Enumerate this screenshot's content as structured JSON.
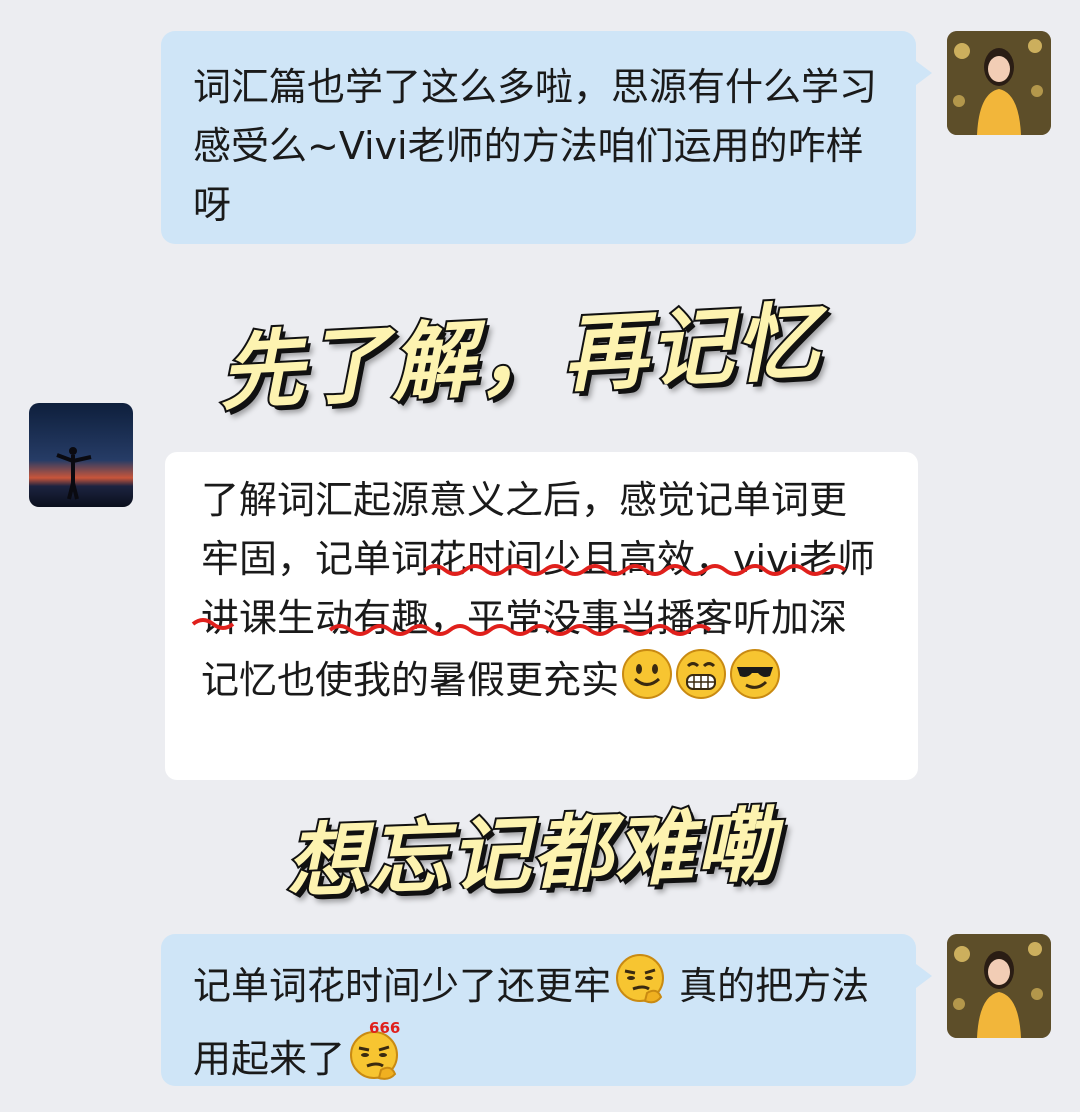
{
  "messages": [
    {
      "side": "right",
      "text": "词汇篇也学了这么多啦，思源有什么学习感受么~Vivi老师的方法咱们运用的咋样呀"
    },
    {
      "side": "left",
      "text": "了解词汇起源意义之后，感觉记单词更牢固，记单词花时间少且高效，vivi老师讲课生动有趣，平常没事当播客听加深记忆也使我的暑假更充实"
    },
    {
      "side": "right",
      "text_a": "记单词花时间少了还更牢",
      "text_b": " 真的把方法用起来了"
    }
  ],
  "captions": {
    "top": "先了解，再记忆",
    "bottom": "想忘记都难嘞"
  },
  "emoji_badge": "666",
  "icons": {
    "emojis_msg2": [
      "slight-smile-emoji",
      "grin-emoji",
      "cool-emoji"
    ],
    "emoji_msg3_a": "thinking-smirk-emoji",
    "emoji_msg3_b": "666-emoji"
  },
  "colors": {
    "background": "#ecedf1",
    "right_bubble": "#cfe5f7",
    "left_bubble": "#ffffff",
    "caption_fill": "#fdf3b0",
    "underline": "#e0201c"
  }
}
